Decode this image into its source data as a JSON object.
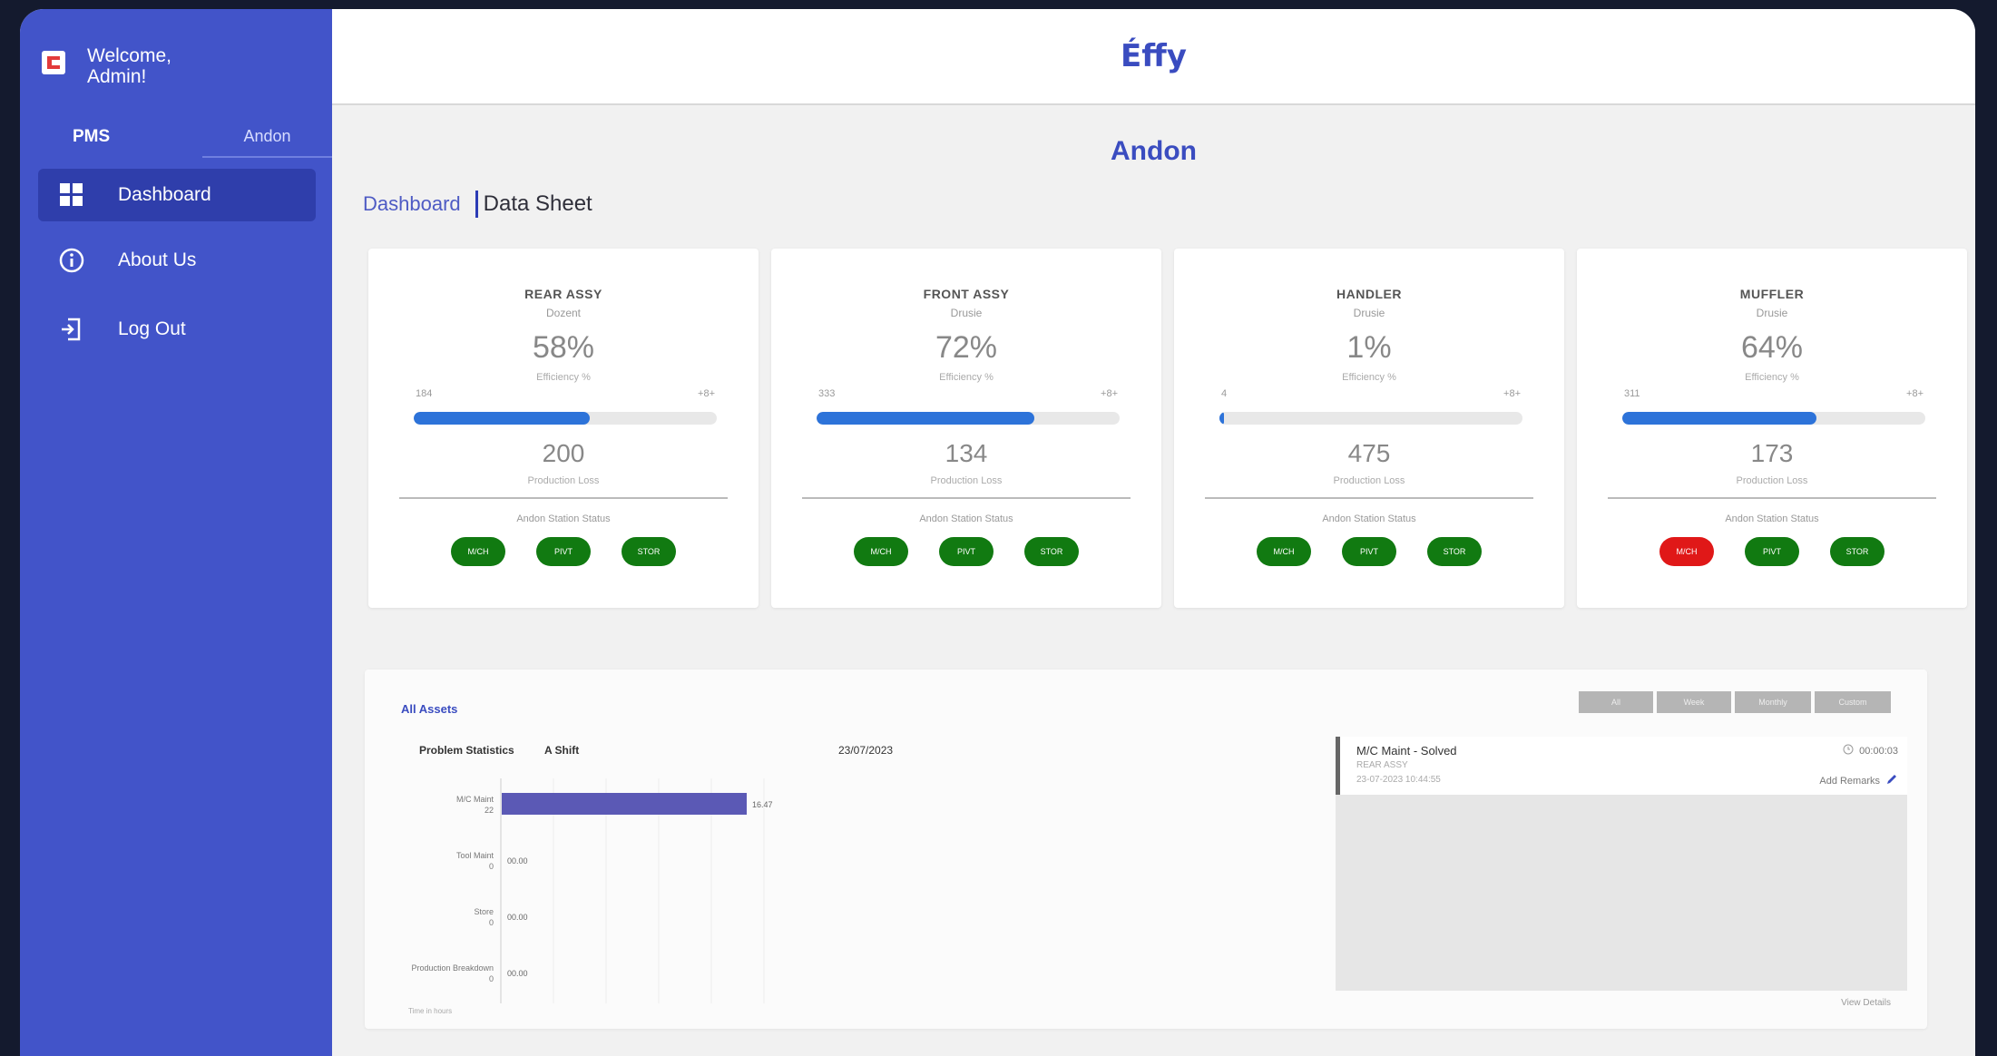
{
  "sidebar": {
    "welcome": "Welcome, Admin!",
    "tabs": [
      {
        "label": "PMS"
      },
      {
        "label": "Andon"
      }
    ],
    "nav": [
      {
        "label": "Dashboard",
        "icon": "dashboard-icon",
        "active": true
      },
      {
        "label": "About Us",
        "icon": "info-icon"
      },
      {
        "label": "Log Out",
        "icon": "logout-icon"
      }
    ]
  },
  "header": {
    "brand": "Éffy"
  },
  "page": {
    "title": "Andon",
    "subtabs": [
      {
        "label": "Dashboard"
      },
      {
        "label": "Data Sheet"
      }
    ]
  },
  "cards": [
    {
      "title": "REAR ASSY",
      "subtitle": "Dozent",
      "efficiency": "58%",
      "efficiency_label": "Efficiency %",
      "min": "184",
      "max": "+8+",
      "fill": 0.58,
      "production": "200",
      "production_label": "Production Loss",
      "status_label": "Andon Station Status",
      "pills": [
        "M/CH",
        "PIVT",
        "STOR"
      ],
      "pill_colors": [
        "#117a11",
        "#117a11",
        "#117a11"
      ]
    },
    {
      "title": "FRONT ASSY",
      "subtitle": "Drusie",
      "efficiency": "72%",
      "efficiency_label": "Efficiency %",
      "min": "333",
      "max": "+8+",
      "fill": 0.72,
      "production": "134",
      "production_label": "Production Loss",
      "status_label": "Andon Station Status",
      "pills": [
        "M/CH",
        "PIVT",
        "STOR"
      ],
      "pill_colors": [
        "#117a11",
        "#117a11",
        "#117a11"
      ]
    },
    {
      "title": "HANDLER",
      "subtitle": "Drusie",
      "efficiency": "1%",
      "efficiency_label": "Efficiency %",
      "min": "4",
      "max": "+8+",
      "fill": 0.01,
      "production": "475",
      "production_label": "Production Loss",
      "status_label": "Andon Station Status",
      "pills": [
        "M/CH",
        "PIVT",
        "STOR"
      ],
      "pill_colors": [
        "#117a11",
        "#117a11",
        "#117a11"
      ]
    },
    {
      "title": "MUFFLER",
      "subtitle": "Drusie",
      "efficiency": "64%",
      "efficiency_label": "Efficiency %",
      "min": "311",
      "max": "+8+",
      "fill": 0.64,
      "production": "173",
      "production_label": "Production Loss",
      "status_label": "Andon Station Status",
      "pills": [
        "M/CH",
        "PIVT",
        "STOR"
      ],
      "pill_colors": [
        "#e01818",
        "#117a11",
        "#117a11"
      ]
    }
  ],
  "panel": {
    "title": "All Assets",
    "problem_label": "Problem Statistics",
    "shift": "A Shift",
    "date": "23/07/2023",
    "chart_note": "Time in hours",
    "segments": [
      "All",
      "Week",
      "Monthly",
      "Custom"
    ],
    "log": {
      "title": "M/C Maint - Solved",
      "subtitle": "REAR ASSY",
      "time": "23-07-2023 10:44:55",
      "duration": "00:00:03",
      "remark": "Add Remarks"
    },
    "view_more": "View Details"
  },
  "chart_data": {
    "type": "bar",
    "orientation": "horizontal",
    "categories": [
      "M/C Maint",
      "Tool Maint",
      "Store",
      "Production Breakdown"
    ],
    "category_counts": [
      "22",
      "0",
      "0",
      "0"
    ],
    "values": [
      16.47,
      0,
      0,
      0
    ],
    "value_labels": [
      "16.47",
      "00.00",
      "00.00",
      "00.00"
    ],
    "color": "#5b59b5"
  }
}
